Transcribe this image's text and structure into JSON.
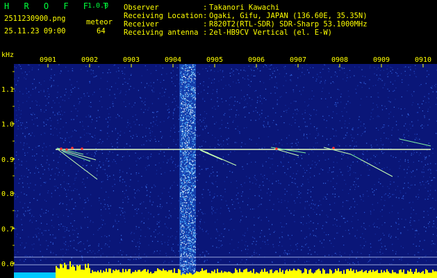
{
  "app": {
    "title": "H R O F F T",
    "version": "1.0.0",
    "filename": "2511230900.png",
    "datetime": "25.11.23 09:00",
    "meteor_label": "meteor",
    "meteor_count": "64"
  },
  "info": [
    {
      "label": "Observer",
      "value": "Takanori Kawachi"
    },
    {
      "label": "Receiving Location",
      "value": "Ogaki, Gifu, JAPAN (136.60E, 35.35N)"
    },
    {
      "label": "Receiver",
      "value": "R820T2(RTL-SDR) SDR-Sharp 53.1000MHz"
    },
    {
      "label": "Receiving antenna",
      "value": "2el-HB9CV Vertical (el. E-W)"
    }
  ],
  "axis": {
    "y_unit": "kHz",
    "y_ticks": [
      "1.1",
      "1.0",
      "0.9",
      "0.8",
      "0.7",
      "0.6"
    ],
    "x_ticks": [
      "0901",
      "0902",
      "0903",
      "0904",
      "0905",
      "0906",
      "0907",
      "0908",
      "0909",
      "0910"
    ]
  },
  "colors": {
    "background": "#0a1678",
    "text_yellow": "#ffff00",
    "title_green": "#00ff3c",
    "signal_line": "#e8ffc0",
    "noise_band": "#3fa8ff",
    "level_bar": "#ffff00",
    "level_bar_cyan": "#00c8ff"
  }
}
